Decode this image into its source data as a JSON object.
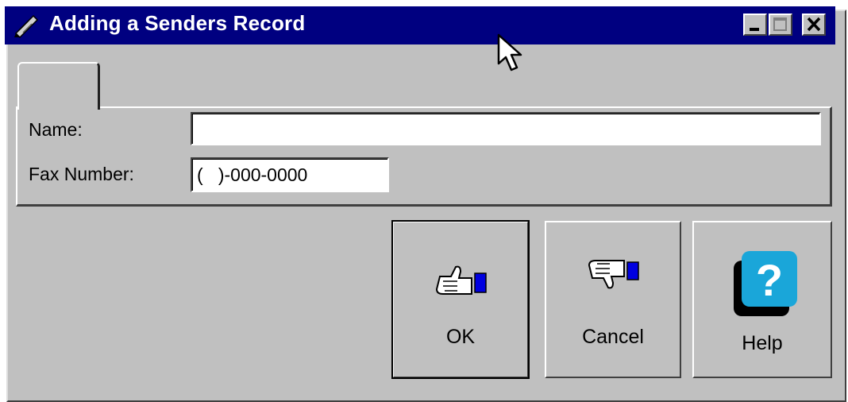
{
  "window": {
    "title": "Adding a Senders Record",
    "title_icon": "pen-feather-icon",
    "controls": {
      "minimize": "minimize-icon",
      "maximize": "maximize-icon",
      "close": "close-icon"
    }
  },
  "form": {
    "tab_label": "",
    "name_label": "Name:",
    "name_value": "",
    "fax_label": "Fax Number:",
    "fax_value": "(   )-000-0000"
  },
  "buttons": {
    "ok": {
      "label": "OK",
      "icon": "thumbs-up-hand-icon"
    },
    "cancel": {
      "label": "Cancel",
      "icon": "thumbs-down-hand-icon"
    },
    "help": {
      "label": "Help",
      "icon": "question-mark-help-icon"
    }
  },
  "colors": {
    "titlebar": "#000080",
    "face": "#c0c0c0",
    "help_blue": "#1aa6d9"
  }
}
